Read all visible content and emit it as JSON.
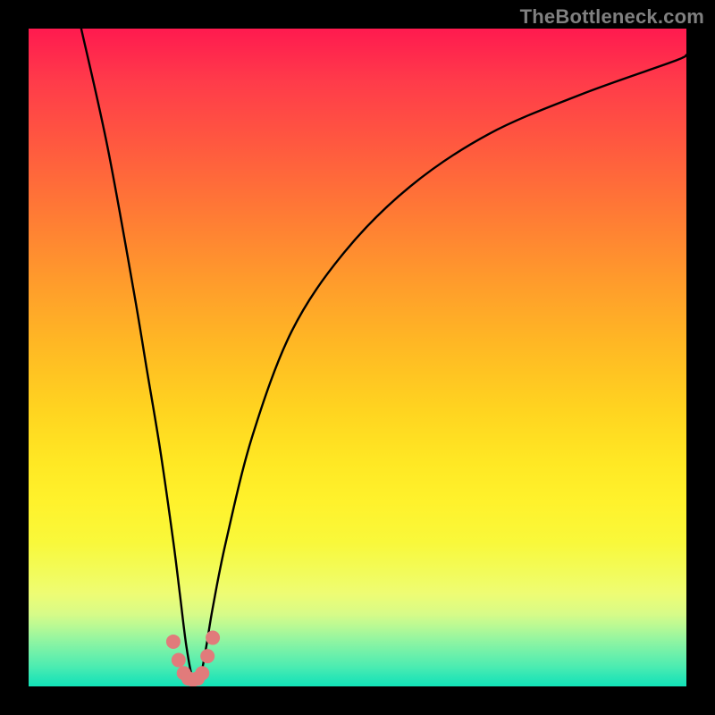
{
  "watermark": "TheBottleneck.com",
  "colors": {
    "gradient_top": "#ff1a4f",
    "gradient_bottom": "#12e2b8",
    "curve": "#000000",
    "marker_fill": "#e17b7b",
    "marker_stroke": "#b55a5a",
    "frame": "#000000"
  },
  "chart_data": {
    "type": "line",
    "title": "",
    "xlabel": "",
    "ylabel": "",
    "xlim": [
      0,
      100
    ],
    "ylim": [
      0,
      100
    ],
    "grid": false,
    "legend": false,
    "series": [
      {
        "name": "main-curve",
        "x": [
          8,
          12,
          16,
          18,
          20,
          22,
          23,
          24,
          25,
          26,
          27,
          28,
          30,
          34,
          40,
          48,
          58,
          70,
          84,
          98,
          100
        ],
        "y": [
          100,
          82,
          60,
          48,
          36,
          22,
          14,
          6,
          1,
          1,
          6,
          12,
          22,
          38,
          54,
          66,
          76,
          84,
          90,
          95,
          96
        ]
      }
    ],
    "markers": {
      "name": "cusp-dots",
      "x": [
        22.0,
        22.8,
        23.6,
        24.3,
        25.0,
        25.7,
        26.4,
        27.2,
        28.0
      ],
      "y": [
        6.8,
        4.0,
        2.0,
        1.2,
        1.0,
        1.2,
        2.0,
        4.6,
        7.4
      ]
    }
  }
}
